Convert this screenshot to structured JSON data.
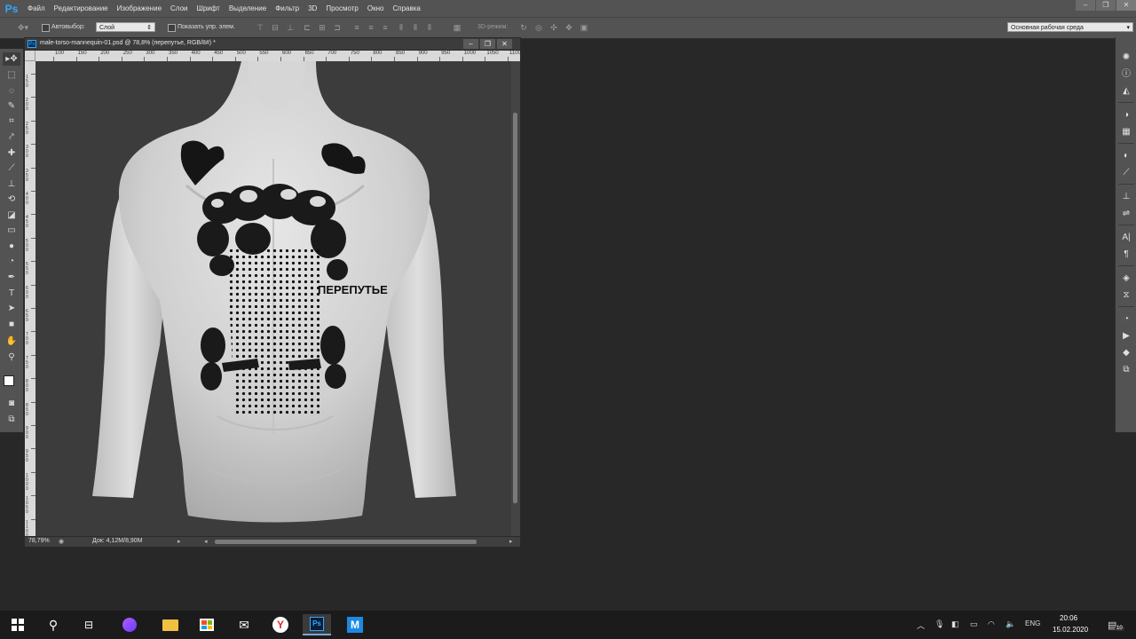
{
  "app": {
    "logo": "Ps",
    "menus": [
      "Файл",
      "Редактирование",
      "Изображение",
      "Слои",
      "Шрифт",
      "Выделение",
      "Фильтр",
      "3D",
      "Просмотр",
      "Окно",
      "Справка"
    ],
    "window_controls": {
      "minimize": "–",
      "restore": "❐",
      "close": "✕"
    }
  },
  "options_bar": {
    "autoselect_label": "Автовыбор:",
    "autoselect_target": "Слой",
    "show_transform_label": "Показать упр. элем.",
    "mode3d_label": "3D-режим:",
    "workspace": "Основная рабочая среда"
  },
  "document": {
    "tab_title": "male-torso-mannequin-01.psd @ 78,8% (перепутье, RGB/8#) *",
    "zoom": "78,79%",
    "doc_size": "Док: 4,12M/8,90M",
    "ruler_top_labels": [
      "100",
      "150",
      "200",
      "250",
      "300",
      "350",
      "400",
      "450",
      "500",
      "550",
      "600",
      "650",
      "700",
      "750",
      "800",
      "850",
      "900",
      "950",
      "1000",
      "1050",
      "1100"
    ],
    "ruler_left_labels": [
      "1 5 0",
      "2 0 0",
      "2 5 0",
      "3 0 0",
      "3 5 0",
      "4 0 0",
      "4 5 0",
      "5 0 0",
      "5 5 0",
      "6 0 0",
      "6 5 0",
      "7 0 0",
      "7 5 0",
      "8 0 0",
      "8 5 0",
      "9 0 0",
      "9 5 0",
      "1 0 0 0",
      "1 0 5 0",
      "1 1 0 0"
    ],
    "tattoo_text": "ПЕРЕПУТЬЕ"
  },
  "taskbar": {
    "lang": "ENG",
    "time": "20:06",
    "date": "15.02.2020",
    "notifications": "10"
  },
  "colors": {
    "accent": "#31a8ff",
    "panel": "#535353",
    "workspace": "#282828"
  }
}
